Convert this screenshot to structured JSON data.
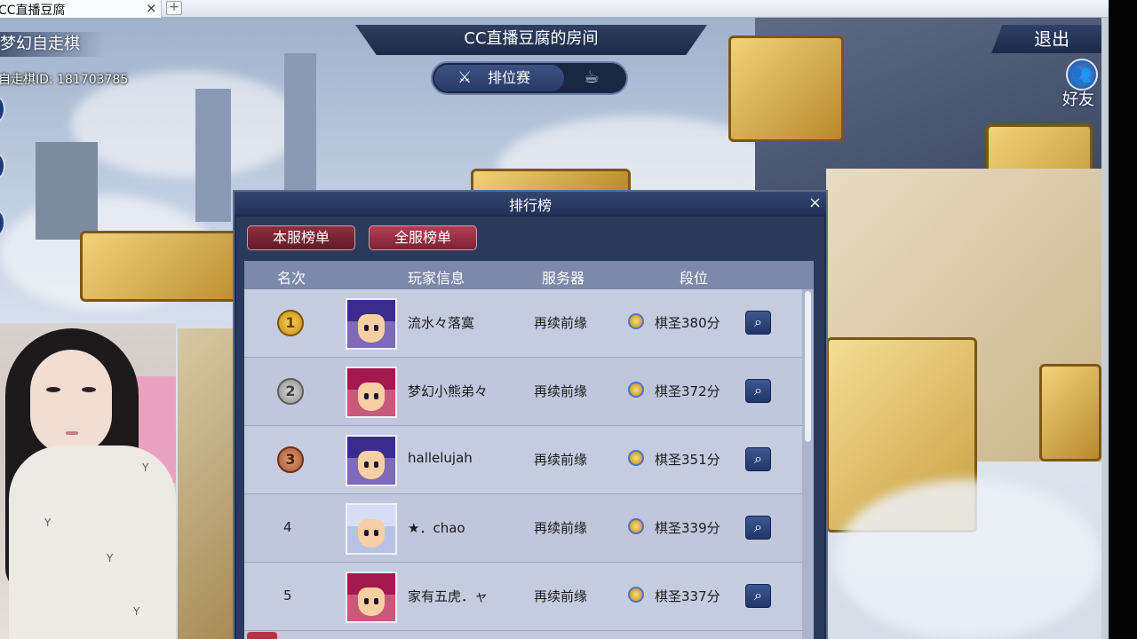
{
  "tab": {
    "title": "CC直播豆腐",
    "close": "×",
    "new": "+"
  },
  "player": {
    "mode": "梦幻自走棋",
    "id_label": "自走棋ID: 181703785"
  },
  "room": {
    "title": "CC直播豆腐的房间",
    "mode_rank": "排位赛",
    "exit": "退出",
    "friends": "好友"
  },
  "leaderboard": {
    "title": "排行榜",
    "close": "×",
    "tabs": {
      "local": "本服榜单",
      "all": "全服榜单"
    },
    "columns": {
      "rank": "名次",
      "player": "玩家信息",
      "server": "服务器",
      "tier": "段位"
    },
    "rows": [
      {
        "rank": "1",
        "name": "流水々落寞",
        "server": "再续前缘",
        "score": "棋圣380分",
        "avatar": "blue"
      },
      {
        "rank": "2",
        "name": "梦幻小熊弟々",
        "server": "再续前缘",
        "score": "棋圣372分",
        "avatar": "red"
      },
      {
        "rank": "3",
        "name": "hallelujah",
        "server": "再续前缘",
        "score": "棋圣351分",
        "avatar": "blue"
      },
      {
        "rank": "4",
        "name": "★．chao",
        "server": "再续前缘",
        "score": "棋圣339分",
        "avatar": "silver"
      },
      {
        "rank": "5",
        "name": "家有五虎．ャ",
        "server": "再续前缘",
        "score": "棋圣337分",
        "avatar": "red"
      }
    ]
  },
  "icons": {
    "search": "search-icon",
    "sword": "sword-icon",
    "cup": "cup-icon",
    "friends": "friends-icon",
    "medal": "medal-icon",
    "tier": "tier-icon"
  },
  "colors": {
    "accent": "#22315a",
    "tab_active": "#8e2f3e",
    "tab_other": "#b43d55"
  }
}
